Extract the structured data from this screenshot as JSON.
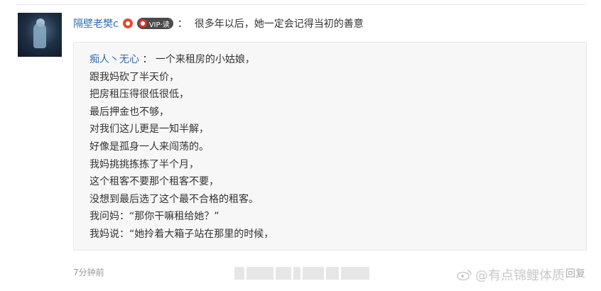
{
  "comment": {
    "username": "隔壁老樊c",
    "vip_label": "VIP·读",
    "colon": "：",
    "text": "很多年以后，她一定会记得当初的善意"
  },
  "quote": {
    "quoted_user": "痴人丶无心",
    "sep": "：",
    "lines": [
      "一个来租房的小姑娘，",
      "跟我妈砍了半天价，",
      "把房租压得很低很低，",
      "最后押金也不够，",
      "对我们这儿更是一知半解，",
      "好像是孤身一人来闯荡的。",
      "我妈挑挑拣拣了半个月，",
      "这个租客不要那个租客不要，",
      "没想到最后选了这个最不合格的租客。",
      "我问妈：“那你干嘛租给她？”",
      "我妈说：“她拎着大箱子站在那里的时候，"
    ]
  },
  "footer": {
    "timestamp": "7分钟前",
    "watermark": "@有点锦鲤体质",
    "reply": "回复"
  },
  "colors": {
    "link_blue": "#2f6cb3",
    "quote_bg": "#f7f7f7",
    "badge_red": "#e8492f"
  }
}
